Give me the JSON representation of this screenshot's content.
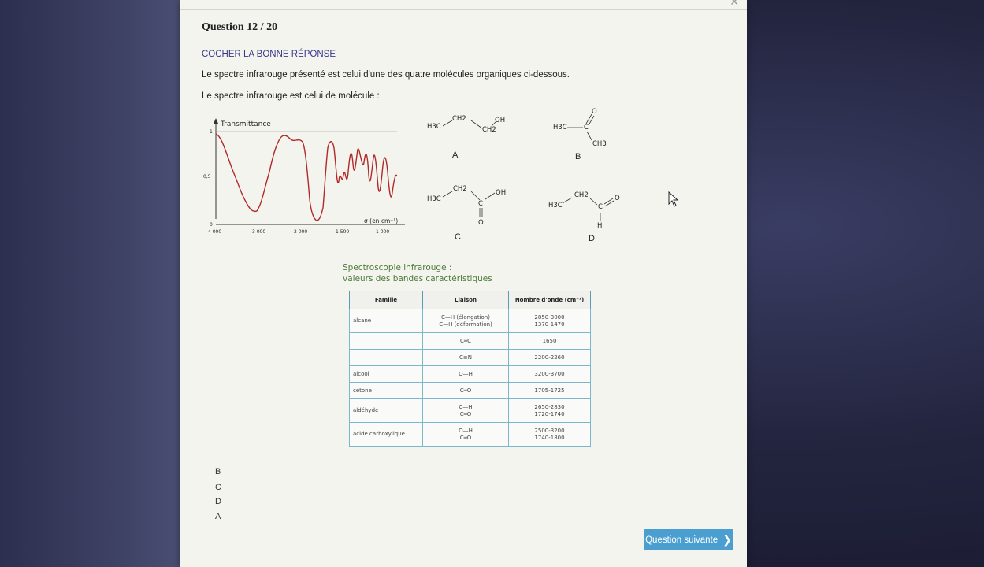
{
  "question": {
    "title": "Question 12 / 20"
  },
  "instruction": "COCHER LA BONNE RÉPONSE",
  "statement": "Le spectre infrarouge présenté est celui d'une des quatre molécules organiques ci-dessous.",
  "prompt": "Le spectre infrarouge est celui de molécule :",
  "spectrum": {
    "y_label": "Transmittance",
    "y_ticks": [
      "1",
      "0,5",
      "0"
    ],
    "x_ticks": [
      "4 000",
      "3 000",
      "2 000",
      "1 500",
      "1 000"
    ],
    "x_label": "σ (en cm⁻¹)"
  },
  "molecules": [
    {
      "letter": "A",
      "h3c": "H3C",
      "ch2a": "CH2",
      "ch2b": "CH2",
      "oh": "OH"
    },
    {
      "letter": "B",
      "h3c": "H3C",
      "c": "C",
      "o": "O",
      "ch3": "CH3"
    },
    {
      "letter": "C",
      "h3c": "H3C",
      "ch2": "CH2",
      "c": "C",
      "oh": "OH",
      "o": "O"
    },
    {
      "letter": "D",
      "h3c": "H3C",
      "ch2": "CH2",
      "c": "C",
      "o": "O",
      "h": "H"
    }
  ],
  "spectro": {
    "title_line1": "Spectroscopie infrarouge :",
    "title_line2": "valeurs des bandes caractéristiques"
  },
  "bands_table": {
    "headers": [
      "Famille",
      "Liaison",
      "Nombre d'onde (cm⁻¹)"
    ],
    "rows": [
      {
        "famille": "alcane",
        "liaison1": "C—H (élongation)",
        "liaison2": "C—H (déformation)",
        "onde1": "2850-3000",
        "onde2": "1370-1470"
      },
      {
        "famille": "",
        "liaison1": "C═C",
        "onde1": "1650"
      },
      {
        "famille": "",
        "liaison1": "C≡N",
        "onde1": "2200-2260"
      },
      {
        "famille": "alcool",
        "liaison1": "O—H",
        "onde1": "3200-3700"
      },
      {
        "famille": "cétone",
        "liaison1": "C═O",
        "onde1": "1705-1725"
      },
      {
        "famille": "aldéhyde",
        "liaison1": "C—H",
        "liaison2": "C═O",
        "onde1": "2650-2830",
        "onde2": "1720-1740"
      },
      {
        "famille": "acide carboxylique",
        "liaison1": "O—H",
        "liaison2": "C═O",
        "onde1": "2500-3200",
        "onde2": "1740-1800"
      }
    ]
  },
  "answers": [
    "B",
    "C",
    "D",
    "A"
  ],
  "next_button": {
    "label": "Question suivante",
    "icon": "chevron-right-icon"
  },
  "colors": {
    "accent": "#4b9ed0",
    "spectrum": "#b02a2a",
    "instruction": "#3a3a8c"
  }
}
